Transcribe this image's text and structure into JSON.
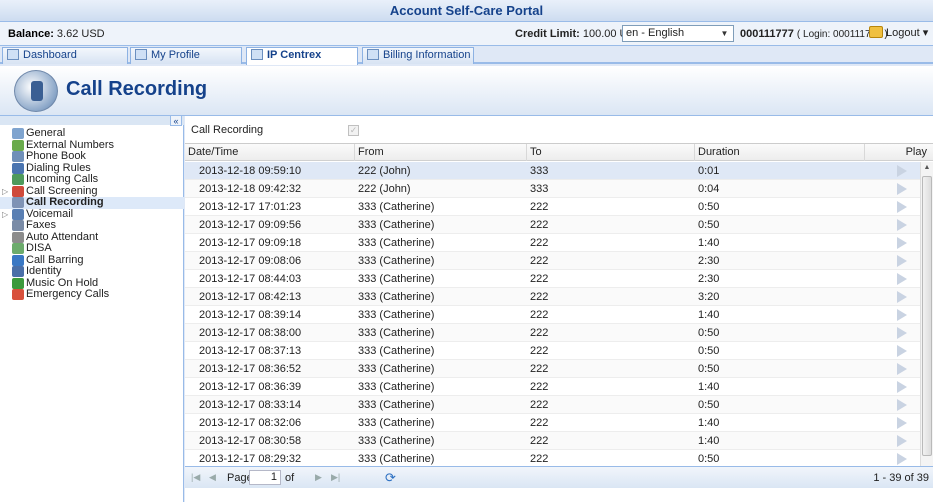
{
  "window": {
    "title": "Account Self-Care Portal"
  },
  "topbar": {
    "balance_label": "Balance:",
    "balance_value": "3.62 USD",
    "credit_label": "Credit Limit:",
    "credit_value": "100.00 USD",
    "language": "en - English",
    "account_id": "000111777",
    "login_text": "( Login: 000111777 )",
    "logout_label": "Logout"
  },
  "tabs": [
    {
      "label": "Dashboard",
      "icon": "dashboard-icon"
    },
    {
      "label": "My Profile",
      "icon": "profile-icon"
    },
    {
      "label": "IP Centrex",
      "icon": "centrex-icon",
      "active": true
    },
    {
      "label": "Billing Information",
      "icon": "billing-icon"
    }
  ],
  "header": {
    "title": "Call Recording",
    "icon": "call-recording-icon"
  },
  "sidebar": {
    "items": [
      {
        "label": "General",
        "icon": "gear-icon",
        "color": "#7fa4cf"
      },
      {
        "label": "External Numbers",
        "icon": "globe-icon",
        "color": "#6aab4c"
      },
      {
        "label": "Phone Book",
        "icon": "phonebook-icon",
        "color": "#6f8fb8"
      },
      {
        "label": "Dialing Rules",
        "icon": "rules-icon",
        "color": "#4a74b0"
      },
      {
        "label": "Incoming Calls",
        "icon": "incoming-icon",
        "color": "#4e9a5c"
      },
      {
        "label": "Call Screening",
        "icon": "screening-icon",
        "color": "#d04a3a",
        "expandable": true
      },
      {
        "label": "Call Recording",
        "icon": "recording-icon",
        "color": "#7f93b5",
        "active": true
      },
      {
        "label": "Voicemail",
        "icon": "voicemail-icon",
        "color": "#5a7fb3",
        "expandable": true
      },
      {
        "label": "Faxes",
        "icon": "fax-icon",
        "color": "#7a8ba6"
      },
      {
        "label": "Auto Attendant",
        "icon": "attendant-icon",
        "color": "#8c8c8c"
      },
      {
        "label": "DISA",
        "icon": "disa-icon",
        "color": "#6cab6c"
      },
      {
        "label": "Call Barring",
        "icon": "barring-icon",
        "color": "#3a78c4"
      },
      {
        "label": "Identity",
        "icon": "identity-icon",
        "color": "#4a6fa8"
      },
      {
        "label": "Music On Hold",
        "icon": "music-icon",
        "color": "#3c9a3c"
      },
      {
        "label": "Emergency Calls",
        "icon": "emergency-icon",
        "color": "#d8503c"
      }
    ]
  },
  "main": {
    "call_recording_label": "Call Recording",
    "columns": [
      "Date/Time",
      "From",
      "To",
      "Duration",
      "Play"
    ],
    "rows": [
      [
        "2013-12-18 09:59:10",
        "222 (John)",
        "333",
        "0:01"
      ],
      [
        "2013-12-18 09:42:32",
        "222 (John)",
        "333",
        "0:04"
      ],
      [
        "2013-12-17 17:01:23",
        "333 (Catherine)",
        "222",
        "0:50"
      ],
      [
        "2013-12-17 09:09:56",
        "333 (Catherine)",
        "222",
        "0:50"
      ],
      [
        "2013-12-17 09:09:18",
        "333 (Catherine)",
        "222",
        "1:40"
      ],
      [
        "2013-12-17 09:08:06",
        "333 (Catherine)",
        "222",
        "2:30"
      ],
      [
        "2013-12-17 08:44:03",
        "333 (Catherine)",
        "222",
        "2:30"
      ],
      [
        "2013-12-17 08:42:13",
        "333 (Catherine)",
        "222",
        "3:20"
      ],
      [
        "2013-12-17 08:39:14",
        "333 (Catherine)",
        "222",
        "1:40"
      ],
      [
        "2013-12-17 08:38:00",
        "333 (Catherine)",
        "222",
        "0:50"
      ],
      [
        "2013-12-17 08:37:13",
        "333 (Catherine)",
        "222",
        "0:50"
      ],
      [
        "2013-12-17 08:36:52",
        "333 (Catherine)",
        "222",
        "0:50"
      ],
      [
        "2013-12-17 08:36:39",
        "333 (Catherine)",
        "222",
        "1:40"
      ],
      [
        "2013-12-17 08:33:14",
        "333 (Catherine)",
        "222",
        "0:50"
      ],
      [
        "2013-12-17 08:32:06",
        "333 (Catherine)",
        "222",
        "1:40"
      ],
      [
        "2013-12-17 08:30:58",
        "333 (Catherine)",
        "222",
        "1:40"
      ],
      [
        "2013-12-17 08:29:32",
        "333 (Catherine)",
        "222",
        "0:50"
      ]
    ]
  },
  "pager": {
    "page_label": "Page",
    "page_value": "1",
    "of_label": "of",
    "display": "1 - 39 of 39"
  }
}
